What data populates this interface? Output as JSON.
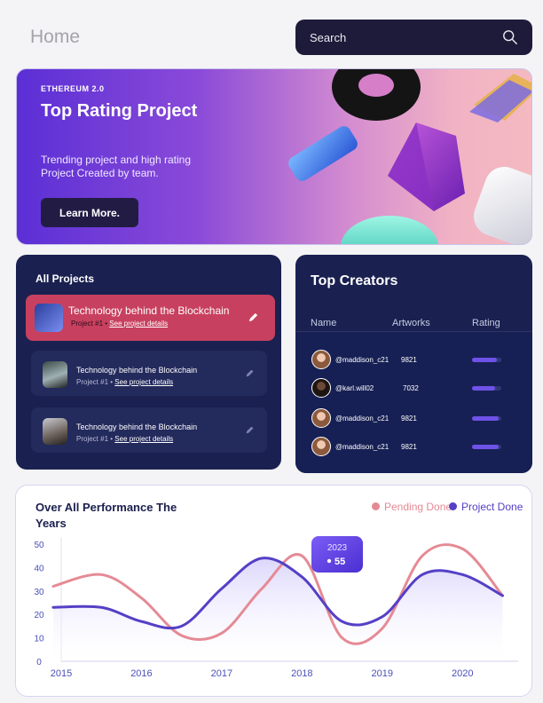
{
  "header": {
    "title": "Home",
    "search_placeholder": "Search"
  },
  "hero": {
    "eyebrow": "ETHEREUM 2.0",
    "title": "Top Rating Project",
    "description": "Trending project and high rating Project Created by team.",
    "button_label": "Learn More."
  },
  "projects": {
    "title": "All Projects",
    "items": [
      {
        "name": "Technology behind the Blockchain",
        "number": "Project #1",
        "link": "See project details"
      },
      {
        "name": "Technology behind the Blockchain",
        "number": "Project #1",
        "link": "See project details"
      },
      {
        "name": "Technology behind the Blockchain",
        "number": "Project #1",
        "link": "See project details"
      }
    ]
  },
  "creators": {
    "title": "Top Creators",
    "columns": [
      "Name",
      "Artworks",
      "Rating"
    ],
    "rows": [
      {
        "handle": "@maddison_c21",
        "artworks": "9821",
        "rating": 0.85
      },
      {
        "handle": "@karl.will02",
        "artworks": "7032",
        "rating": 0.78
      },
      {
        "handle": "@maddison_c21",
        "artworks": "9821",
        "rating": 0.92
      },
      {
        "handle": "@maddison_c21",
        "artworks": "9821",
        "rating": 0.9
      }
    ]
  },
  "performance": {
    "title": "Over  All Performance The Years",
    "legend": [
      {
        "label": "Pending Done",
        "color": "#e58a94"
      },
      {
        "label": "Project Done",
        "color": "#5440c6"
      }
    ],
    "tooltip": {
      "year": "2023",
      "value": "55"
    }
  },
  "chart_data": {
    "type": "line",
    "x": [
      2014.9,
      2015.5,
      2016,
      2016.5,
      2017,
      2017.5,
      2018,
      2018.5,
      2019,
      2019.5,
      2020,
      2020.5
    ],
    "xticks": [
      "2015",
      "2016",
      "2017",
      "2018",
      "2019",
      "2020"
    ],
    "yticks": [
      "0",
      "10",
      "20",
      "30",
      "40",
      "50"
    ],
    "ylim": [
      0,
      50
    ],
    "series": [
      {
        "name": "Pending Done",
        "values": [
          32,
          37,
          27,
          11,
          12,
          31,
          45,
          10,
          14,
          45,
          48,
          28
        ]
      },
      {
        "name": "Project Done",
        "values": [
          23,
          23,
          17,
          15,
          31,
          44,
          36,
          17,
          19,
          37,
          37,
          28
        ]
      }
    ]
  }
}
